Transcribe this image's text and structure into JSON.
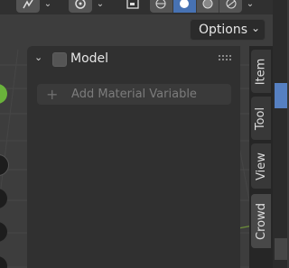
{
  "header": {
    "icons": [
      "select-mode-icon",
      "proportional-edit-icon",
      "display-icon",
      "viewport-shading-icons"
    ]
  },
  "options": {
    "label": "Options"
  },
  "panel": {
    "title": "Model",
    "add_button_label": "Add Material Variable"
  },
  "tabs": [
    {
      "label": "Item"
    },
    {
      "label": "Tool"
    },
    {
      "label": "View"
    },
    {
      "label": "Crowd"
    }
  ]
}
